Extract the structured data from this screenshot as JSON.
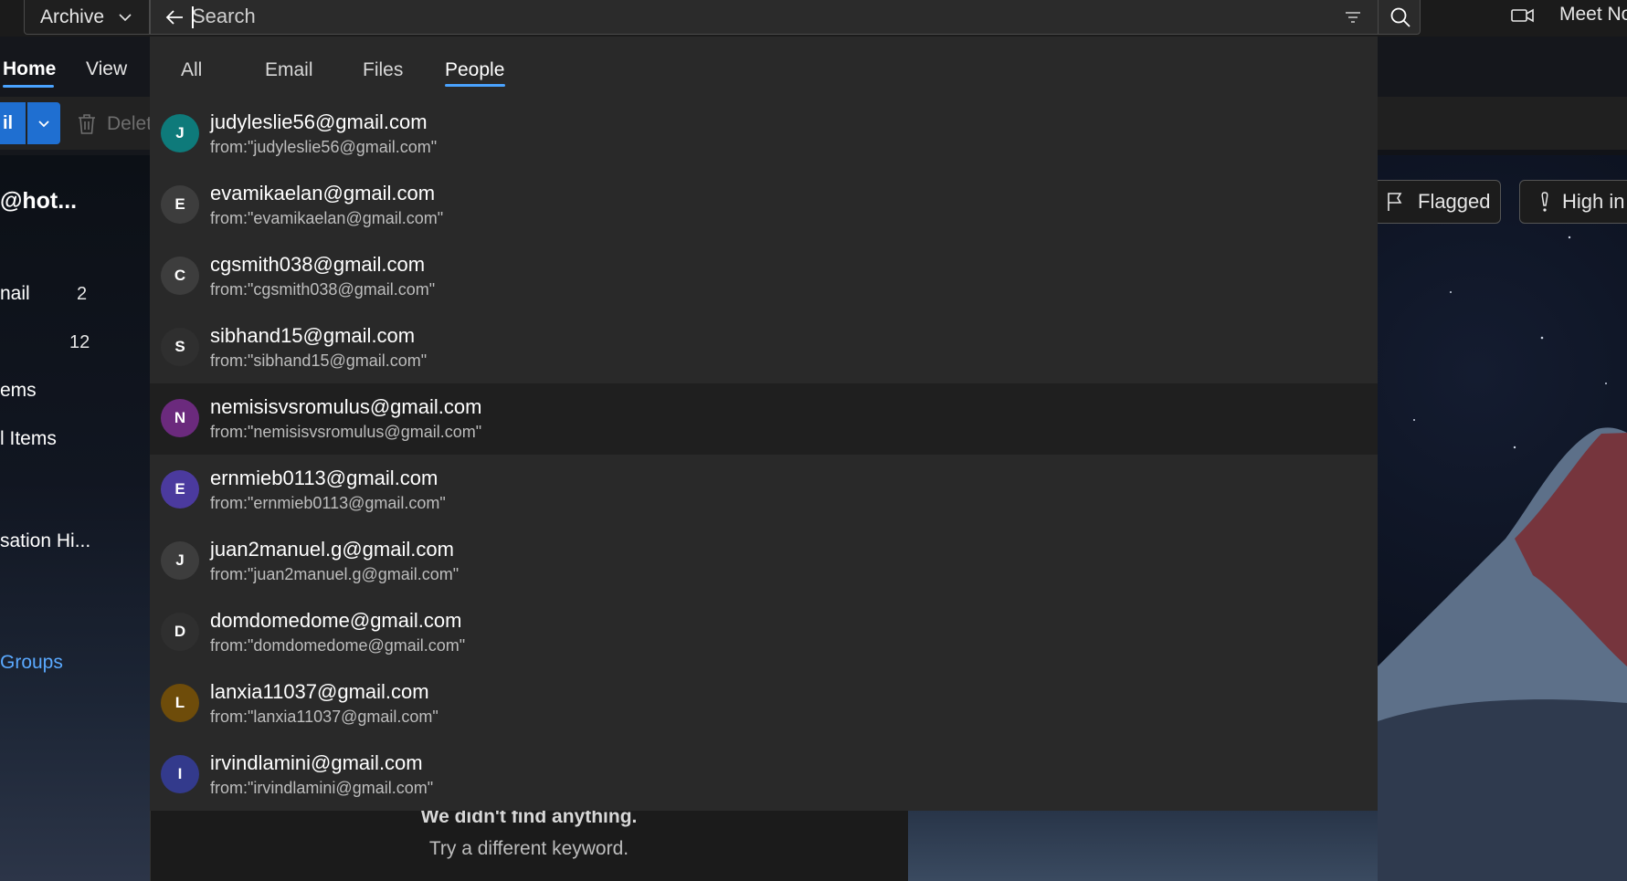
{
  "topbar": {
    "folder_selector": "Archive",
    "search_placeholder": "Search",
    "meet_label": "Meet No"
  },
  "nav": {
    "tabs": [
      {
        "label": "Home",
        "active": true
      },
      {
        "label": "View",
        "active": false
      }
    ]
  },
  "ribbon": {
    "new_mail_label": "il",
    "delete_label": "Delet"
  },
  "folders": {
    "account": "@hot...",
    "items": [
      {
        "label": "nail",
        "count": "2"
      },
      {
        "label": "",
        "count": "12"
      },
      {
        "label": "ems",
        "count": ""
      },
      {
        "label": "l Items",
        "count": ""
      },
      {
        "label": "",
        "count": ""
      },
      {
        "label": "sation Hi...",
        "count": ""
      }
    ],
    "groups_link": "Groups"
  },
  "quick_filters": {
    "flagged": "Flagged",
    "high": "High in"
  },
  "empty_state": {
    "title": "We didn't find anything.",
    "subtitle": "Try a different keyword."
  },
  "search_dropdown": {
    "tabs": [
      {
        "label": "All",
        "active": false
      },
      {
        "label": "Email",
        "active": false
      },
      {
        "label": "Files",
        "active": false
      },
      {
        "label": "People",
        "active": true
      }
    ],
    "results": [
      {
        "initial": "J",
        "color": "#0e7a7a",
        "email": "judyleslie56@gmail.com",
        "query": "from:\"judyleslie56@gmail.com\""
      },
      {
        "initial": "E",
        "color": "#3d3d3d",
        "email": "evamikaelan@gmail.com",
        "query": "from:\"evamikaelan@gmail.com\""
      },
      {
        "initial": "C",
        "color": "#3d3d3d",
        "email": "cgsmith038@gmail.com",
        "query": "from:\"cgsmith038@gmail.com\""
      },
      {
        "initial": "S",
        "color": "#2f2f2f",
        "email": "sibhand15@gmail.com",
        "query": "from:\"sibhand15@gmail.com\""
      },
      {
        "initial": "N",
        "color": "#6b2a7d",
        "email": "nemisisvsromulus@gmail.com",
        "query": "from:\"nemisisvsromulus@gmail.com\""
      },
      {
        "initial": "E",
        "color": "#4b3a9e",
        "email": "ernmieb0113@gmail.com",
        "query": "from:\"ernmieb0113@gmail.com\""
      },
      {
        "initial": "J",
        "color": "#3d3d3d",
        "email": "juan2manuel.g@gmail.com",
        "query": "from:\"juan2manuel.g@gmail.com\""
      },
      {
        "initial": "D",
        "color": "#2f2f2f",
        "email": "domdomedome@gmail.com",
        "query": "from:\"domdomedome@gmail.com\""
      },
      {
        "initial": "L",
        "color": "#6e4c0a",
        "email": "lanxia11037@gmail.com",
        "query": "from:\"lanxia11037@gmail.com\""
      },
      {
        "initial": "I",
        "color": "#333a8c",
        "email": "irvindlamini@gmail.com",
        "query": "from:\"irvindlamini@gmail.com\""
      }
    ]
  }
}
